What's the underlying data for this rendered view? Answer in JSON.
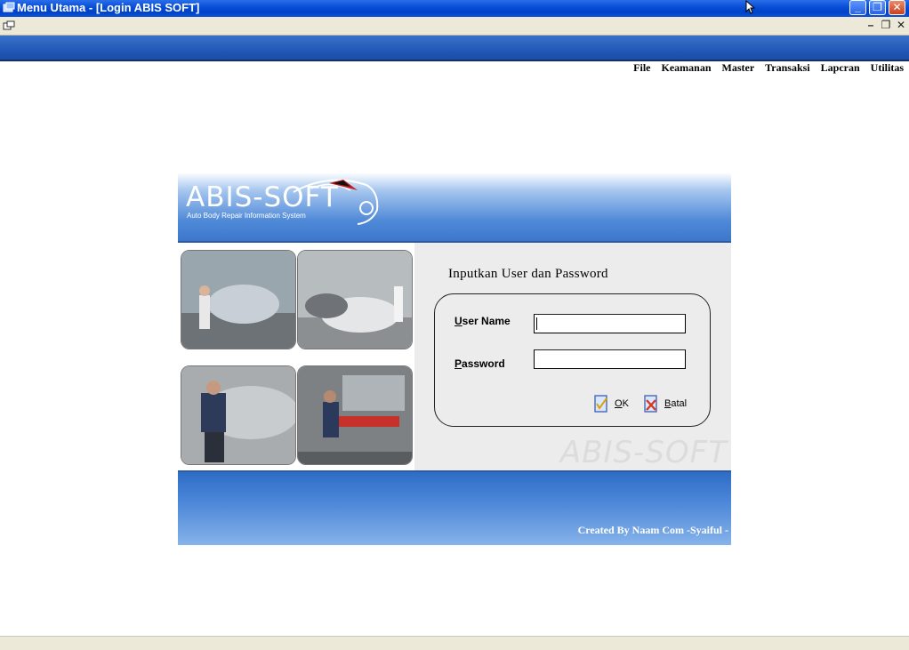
{
  "window": {
    "title": "Menu Utama - [Login ABIS SOFT]",
    "app_icon": "app-icon",
    "controls": [
      "minimize-icon",
      "restore-icon",
      "close-icon"
    ]
  },
  "mdi": {
    "child_icon": "document-icon",
    "controls": [
      "minimize-icon",
      "restore-icon",
      "close-icon"
    ],
    "minimize_glyph": "–",
    "restore_glyph": "❐",
    "close_glyph": "✕"
  },
  "menu": {
    "items": [
      "File",
      "Keamanan",
      "Master",
      "Transaksi",
      "Lapcran",
      "Utilitas"
    ]
  },
  "login": {
    "logo": "ABIS-SOFT",
    "logo_subtitle": "Auto Body Repair Information System",
    "heading": "Inputkan User dan Password",
    "username_label_u": "U",
    "username_label_rest": "ser Name",
    "password_label_u": "P",
    "password_label_rest": "assword",
    "username_value": "",
    "password_value": "",
    "ok_label_u": "O",
    "ok_label_rest": "K",
    "cancel_label_u": "B",
    "cancel_label_rest": "atal",
    "watermark": "ABIS-SOFT",
    "credit": "Created By Naam Com -Syaiful -"
  },
  "colors": {
    "titlebar": "#0a4fd8",
    "band": "#2359b8",
    "panel_blue": "#3d77cc"
  }
}
